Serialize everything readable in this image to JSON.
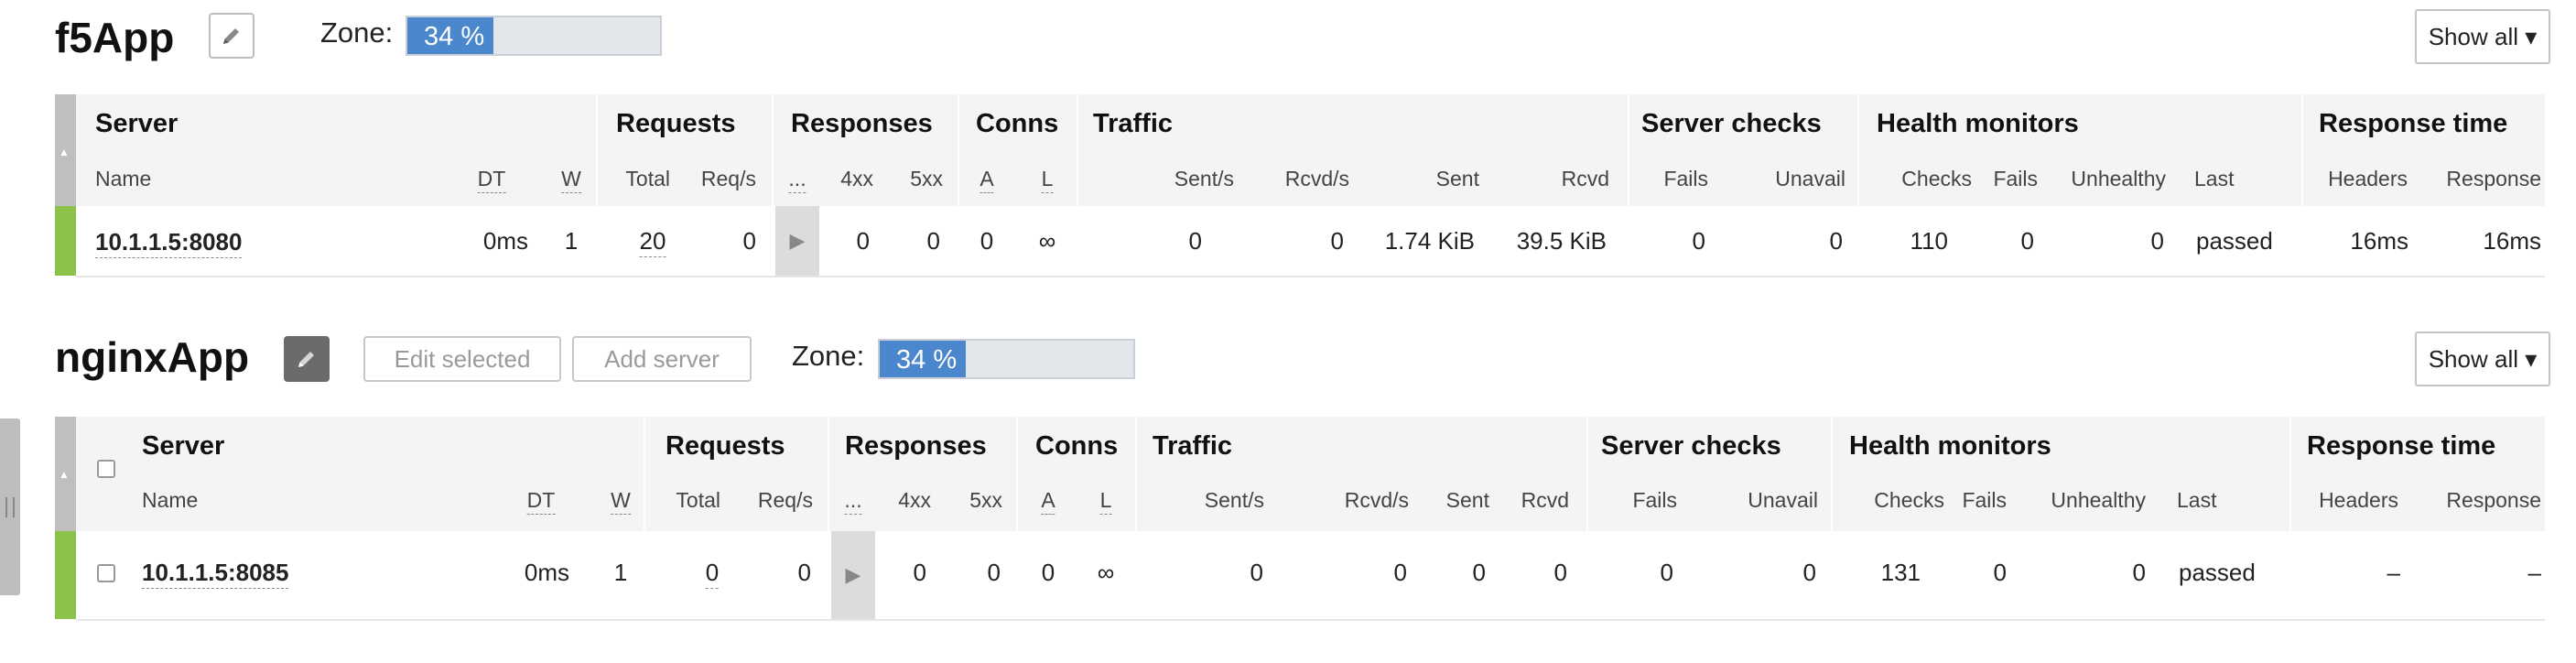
{
  "app1": {
    "title": "f5App",
    "zone_label": "Zone:",
    "zone_value": "34 %",
    "zone_fraction": 0.34,
    "show_all": "Show all ▾",
    "groups": {
      "server": "Server",
      "requests": "Requests",
      "responses": "Responses",
      "conns": "Conns",
      "traffic": "Traffic",
      "server_checks": "Server checks",
      "health_monitors": "Health monitors",
      "response_time": "Response time"
    },
    "sub": {
      "name": "Name",
      "dt": "DT",
      "w": "W",
      "total": "Total",
      "reqs": "Req/s",
      "dots": "...",
      "r4xx": "4xx",
      "r5xx": "5xx",
      "a": "A",
      "l": "L",
      "sent_s": "Sent/s",
      "rcvd_s": "Rcvd/s",
      "sent": "Sent",
      "rcvd": "Rcvd",
      "fails": "Fails",
      "unavail": "Unavail",
      "checks": "Checks",
      "hm_fails": "Fails",
      "unhealthy": "Unhealthy",
      "last": "Last",
      "headers": "Headers",
      "response": "Response"
    },
    "row": {
      "name": "10.1.1.5:8080",
      "dt": "0ms",
      "w": "1",
      "total": "20",
      "reqs": "0",
      "r4xx": "0",
      "r5xx": "0",
      "a": "0",
      "l": "∞",
      "sent_s": "0",
      "rcvd_s": "0",
      "sent": "1.74 KiB",
      "rcvd": "39.5 KiB",
      "fails": "0",
      "unavail": "0",
      "checks": "110",
      "hm_fails": "0",
      "unhealthy": "0",
      "last": "passed",
      "headers": "16ms",
      "response": "16ms"
    }
  },
  "app2": {
    "title": "nginxApp",
    "edit_selected": "Edit selected",
    "add_server": "Add server",
    "zone_label": "Zone:",
    "zone_value": "34 %",
    "zone_fraction": 0.34,
    "show_all": "Show all ▾",
    "groups": {
      "server": "Server",
      "requests": "Requests",
      "responses": "Responses",
      "conns": "Conns",
      "traffic": "Traffic",
      "server_checks": "Server checks",
      "health_monitors": "Health monitors",
      "response_time": "Response time"
    },
    "sub": {
      "name": "Name",
      "dt": "DT",
      "w": "W",
      "total": "Total",
      "reqs": "Req/s",
      "dots": "...",
      "r4xx": "4xx",
      "r5xx": "5xx",
      "a": "A",
      "l": "L",
      "sent_s": "Sent/s",
      "rcvd_s": "Rcvd/s",
      "sent": "Sent",
      "rcvd": "Rcvd",
      "fails": "Fails",
      "unavail": "Unavail",
      "checks": "Checks",
      "hm_fails": "Fails",
      "unhealthy": "Unhealthy",
      "last": "Last",
      "headers": "Headers",
      "response": "Response"
    },
    "row": {
      "name": "10.1.1.5:8085",
      "dt": "0ms",
      "w": "1",
      "total": "0",
      "reqs": "0",
      "r4xx": "0",
      "r5xx": "0",
      "a": "0",
      "l": "∞",
      "sent_s": "0",
      "rcvd_s": "0",
      "sent": "0",
      "rcvd": "0",
      "fails": "0",
      "unavail": "0",
      "checks": "131",
      "hm_fails": "0",
      "unhealthy": "0",
      "last": "passed",
      "headers": "–",
      "response": "–"
    }
  },
  "icons": {
    "edit": "pencil-icon",
    "sort": "sort-arrow-icon",
    "expand": "play-arrow-icon",
    "handle": "resize-grip-icon"
  },
  "colors": {
    "zone_fill": "#4a87cc",
    "status_up": "#8bc34a",
    "header_band": "#f3f4f5"
  }
}
